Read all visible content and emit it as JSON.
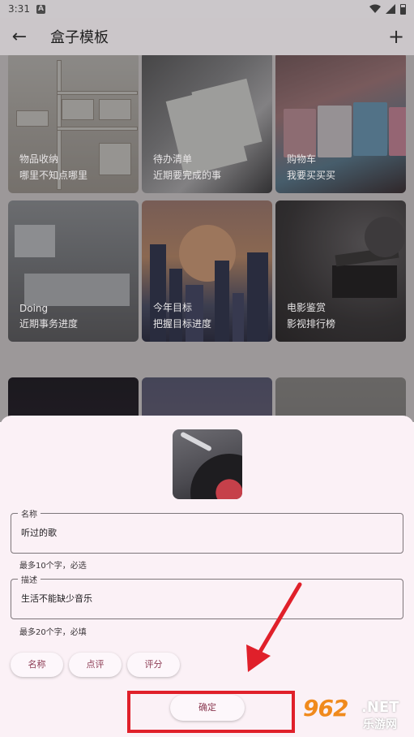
{
  "status_bar": {
    "time": "3:31",
    "notif_letter": "A"
  },
  "app_bar": {
    "title": "盒子模板",
    "back_icon": "←",
    "add_icon": "+"
  },
  "templates": [
    {
      "title": "物品收纳",
      "subtitle": "哪里不知点哪里"
    },
    {
      "title": "待办清单",
      "subtitle": "近期要完成的事"
    },
    {
      "title": "购物车",
      "subtitle": "我要买买买"
    },
    {
      "title": "Doing",
      "subtitle": "近期事务进度"
    },
    {
      "title": "今年目标",
      "subtitle": "把握目标进度"
    },
    {
      "title": "电影鉴赏",
      "subtitle": "影视排行榜"
    }
  ],
  "sheet": {
    "name_field": {
      "label": "名称",
      "value": "听过的歌",
      "hint": "最多10个字，必选"
    },
    "desc_field": {
      "label": "描述",
      "value": "生活不能缺少音乐",
      "hint": "最多20个字，必填"
    },
    "chips": [
      "名称",
      "点评",
      "评分"
    ],
    "confirm_label": "确定"
  },
  "watermark": {
    "logo": "962",
    "net": ".NET",
    "cn": "乐游网"
  },
  "colors": {
    "accent": "#8c3b53",
    "annotation": "#e0202a"
  }
}
